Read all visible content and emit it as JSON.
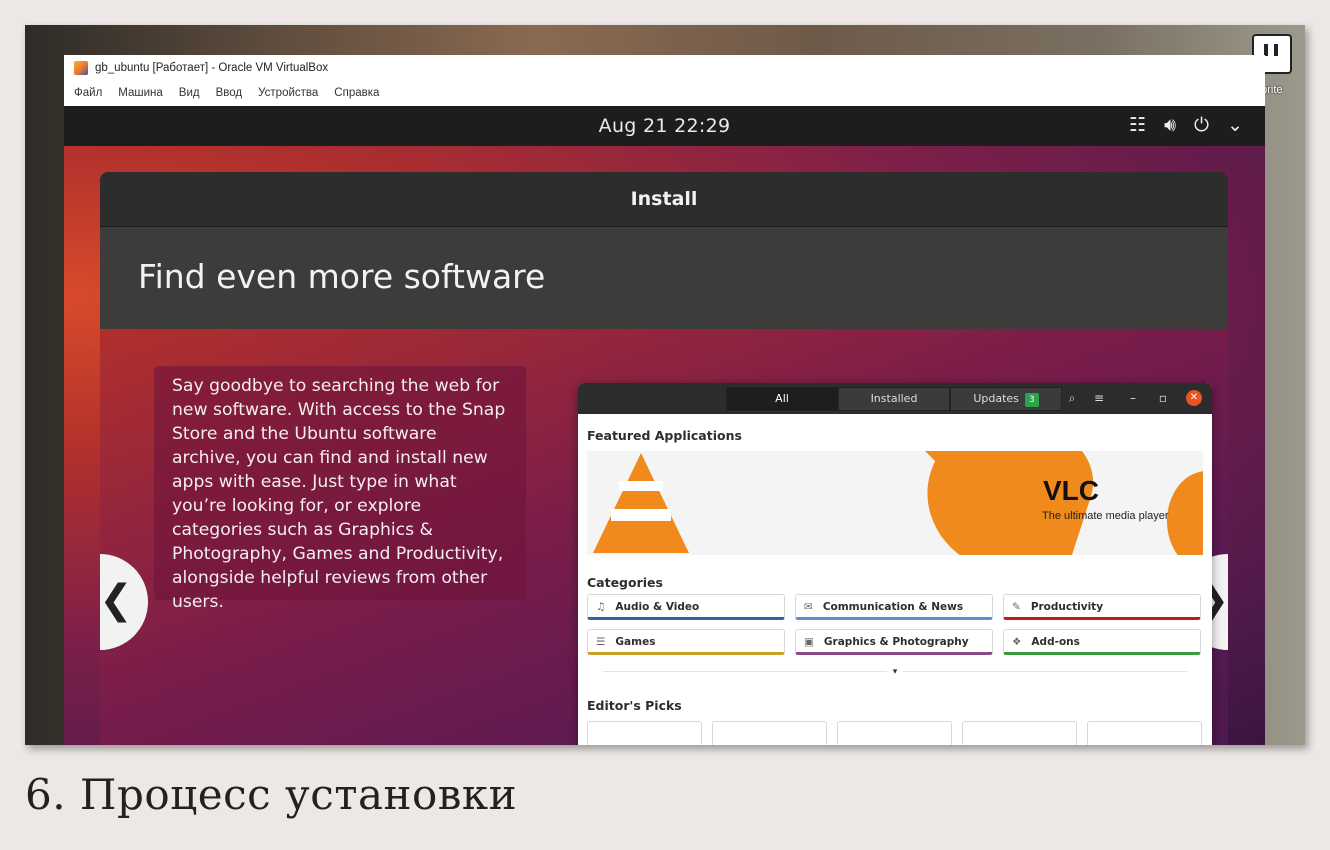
{
  "desktop": {
    "shortcut_label": "eprite"
  },
  "window": {
    "title": "gb_ubuntu [Работает] - Oracle VM VirtualBox"
  },
  "menu": [
    "Файл",
    "Машина",
    "Вид",
    "Ввод",
    "Устройства",
    "Справка"
  ],
  "topbar": {
    "clock": "Aug 21  22:29"
  },
  "installer": {
    "header": "Install",
    "title": "Find even more software",
    "body": "Say goodbye to searching the web for new software. With access to the Snap Store and the Ubuntu software archive, you can find and install new apps with ease. Just type in what you’re looking for, or explore categories such as Graphics & Photography, Games and Productivity, alongside helpful reviews from other users."
  },
  "store": {
    "tabs": {
      "all": "All",
      "installed": "Installed",
      "updates": "Updates",
      "updates_count": "3"
    },
    "featured_heading": "Featured Applications",
    "banner": {
      "name": "VLC",
      "tagline": "The ultimate media player"
    },
    "categories_heading": "Categories",
    "categories": [
      "Audio & Video",
      "Communication & News",
      "Productivity",
      "Games",
      "Graphics & Photography",
      "Add-ons"
    ],
    "editors_heading": "Editor's Picks"
  },
  "caption": "6. Процесс установки"
}
